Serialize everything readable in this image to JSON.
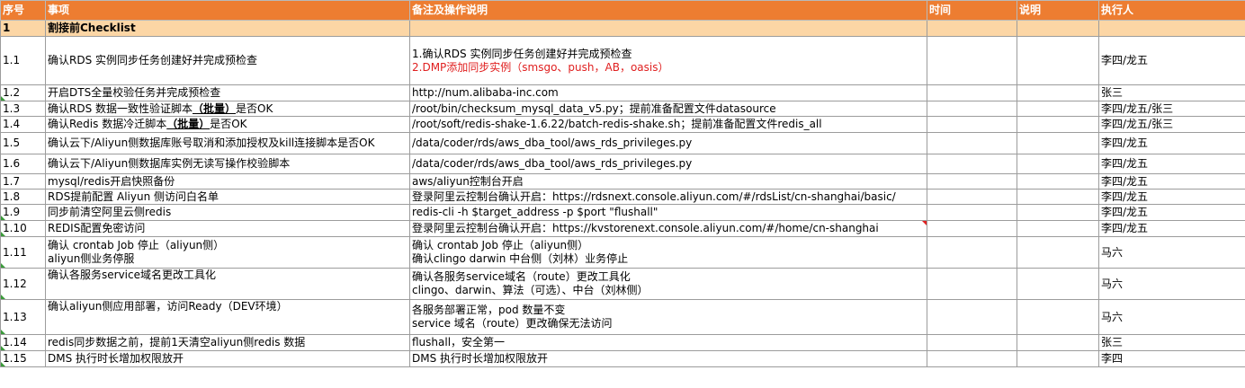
{
  "headers": [
    "序号",
    "事项",
    "备注及操作说明",
    "时间",
    "说明",
    "执行人"
  ],
  "section": {
    "num": "1",
    "title": "割接前Checklist"
  },
  "rows": [
    {
      "num": "1.1",
      "task": "确认RDS 实例同步任务创建好并完成预检查",
      "note_lines": [
        "1.确认RDS 实例同步任务创建好并完成预检查",
        "2.DMP添加同步实例（smsgo、push，AB，oasis）"
      ],
      "owner": "李四/龙五"
    },
    {
      "num": "1.2",
      "task": "开启DTS全量校验任务并完成预检查",
      "note": "http://num.alibaba-inc.com",
      "owner": "张三"
    },
    {
      "num": "1.3",
      "task_pre": "确认RDS 数据一致性验证脚本",
      "task_ul": "（批量）",
      "task_post": "是否OK",
      "note": "/root/bin/checksum_mysql_data_v5.py；提前准备配置文件datasource",
      "owner": "李四/龙五/张三"
    },
    {
      "num": "1.4",
      "task_pre": "确认Redis 数据冷迁脚本",
      "task_ul": "（批量）",
      "task_post": "是否OK",
      "note": "/root/soft/redis-shake-1.6.22/batch-redis-shake.sh；提前准备配置文件redis_all",
      "owner": "李四/龙五/张三"
    },
    {
      "num": "1.5",
      "task": "确认云下/Aliyun侧数据库账号取消和添加授权及kill连接脚本是否OK",
      "note": "/data/coder/rds/aws_dba_tool/aws_rds_privileges.py",
      "owner": "李四/龙五"
    },
    {
      "num": "1.6",
      "task": "确认云下/Aliyun侧数据库实例无读写操作校验脚本",
      "note": "/data/coder/rds/aws_dba_tool/aws_rds_privileges.py",
      "owner": "李四/龙五"
    },
    {
      "num": "1.7",
      "task": "mysql/redis开启快照备份",
      "note": "aws/aliyun控制台开启",
      "owner": "李四/龙五"
    },
    {
      "num": "1.8",
      "task": "RDS提前配置 Aliyun 侧访问白名单",
      "note": "登录阿里云控制台确认开启：https://rdsnext.console.aliyun.com/#/rdsList/cn-shanghai/basic/",
      "owner": "李四/龙五"
    },
    {
      "num": "1.9",
      "task": "同步前清空阿里云侧redis",
      "note": "redis-cli -h $target_address -p $port \"flushall\"",
      "owner": "李四/龙五"
    },
    {
      "num": "1.10",
      "task": "REDIS配置免密访问",
      "note": "登录阿里云控制台确认开启：https://kvstorenext.console.aliyun.com/#/home/cn-shanghai",
      "owner": "李四/龙五"
    },
    {
      "num": "1.11",
      "task_lines": [
        "确认 crontab Job 停止（aliyun侧）",
        "aliyun侧业务停服"
      ],
      "note_lines": [
        "确认 crontab Job 停止（aliyun侧）",
        "确认clingo  darwin 中台侧（刘林）业务停止"
      ],
      "owner": "马六"
    },
    {
      "num": "1.12",
      "task": "确认各服务service域名更改工具化",
      "note_lines": [
        "确认各服务service域名（route）更改工具化",
        "clingo、darwin、算法（可选）、中台（刘林侧）"
      ],
      "owner": "马六"
    },
    {
      "num": "1.13",
      "task": "确认aliyun侧应用部署，访问Ready（DEV环境）",
      "note_lines": [
        "各服务部署正常，pod 数量不变",
        "service 域名（route）更改确保无法访问"
      ],
      "owner": "马六"
    },
    {
      "num": "1.14",
      "task": "redis同步数据之前，提前1天清空aliyun侧redis 数据",
      "note": "flushall，安全第一",
      "owner": "张三"
    },
    {
      "num": "1.15",
      "task": "DMS 执行时长增加权限放开",
      "note": "DMS 执行时长增加权限放开",
      "owner": "李四"
    }
  ]
}
